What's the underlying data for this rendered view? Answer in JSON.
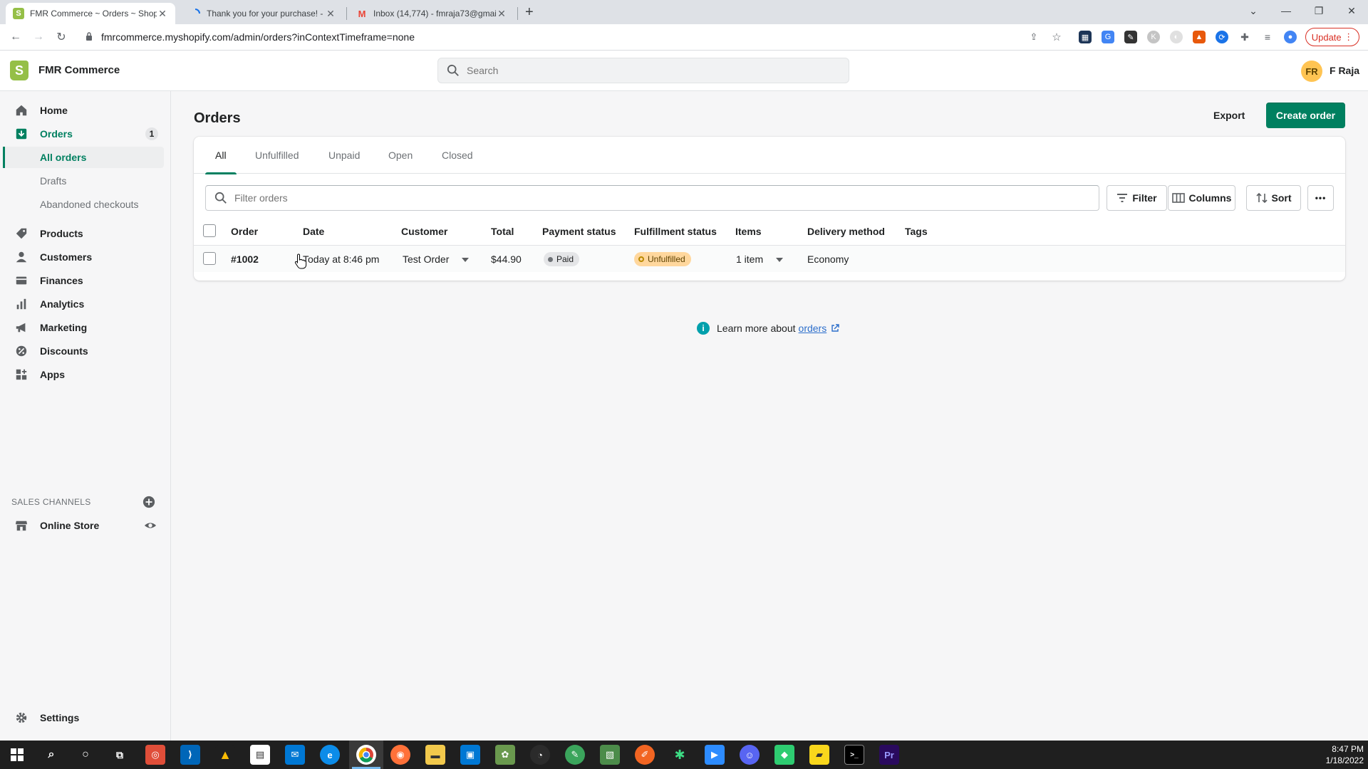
{
  "browser": {
    "tabs": [
      {
        "title": "FMR Commerce ~ Orders ~ Shop",
        "active": true
      },
      {
        "title": "Thank you for your purchase! - F"
      },
      {
        "title": "Inbox (14,774) - fmraja73@gmail"
      }
    ],
    "new_tab": "+",
    "url": "fmrcommerce.myshopify.com/admin/orders?inContextTimeframe=none",
    "update_label": "Update"
  },
  "topbar": {
    "store_name": "FMR Commerce",
    "search_placeholder": "Search",
    "avatar_initials": "FR",
    "user_name": "F Raja"
  },
  "sidebar": {
    "items": [
      {
        "label": "Home",
        "icon": "home-icon"
      },
      {
        "label": "Orders",
        "icon": "orders-icon",
        "badge": "1"
      },
      {
        "label": "Products",
        "icon": "tag-icon"
      },
      {
        "label": "Customers",
        "icon": "person-icon"
      },
      {
        "label": "Finances",
        "icon": "finances-icon"
      },
      {
        "label": "Analytics",
        "icon": "bar-chart-icon"
      },
      {
        "label": "Marketing",
        "icon": "megaphone-icon"
      },
      {
        "label": "Discounts",
        "icon": "discount-icon"
      },
      {
        "label": "Apps",
        "icon": "apps-icon"
      }
    ],
    "order_subitems": [
      "All orders",
      "Drafts",
      "Abandoned checkouts"
    ],
    "sales_channels_label": "SALES CHANNELS",
    "online_store": "Online Store",
    "settings": "Settings"
  },
  "main": {
    "title": "Orders",
    "export_label": "Export",
    "create_label": "Create order",
    "tabs": [
      "All",
      "Unfulfilled",
      "Unpaid",
      "Open",
      "Closed"
    ],
    "filter_placeholder": "Filter orders",
    "filter_label": "Filter",
    "columns_label": "Columns",
    "sort_label": "Sort",
    "more_label": "•••",
    "headers": [
      "Order",
      "Date",
      "Customer",
      "Total",
      "Payment status",
      "Fulfillment status",
      "Items",
      "Delivery method",
      "Tags"
    ],
    "rows": [
      {
        "order": "#1002",
        "date": "Today at 8:46 pm",
        "customer": "Test Order",
        "total": "$44.90",
        "payment": "Paid",
        "fulfillment": "Unfulfilled",
        "items": "1 item",
        "delivery": "Economy",
        "tags": ""
      }
    ],
    "learn_text": "Learn more about",
    "learn_link": "orders"
  },
  "colors": {
    "primary": "#008060",
    "paid_badge": "#e4e5e7",
    "unfulfilled_badge": "#ffd79d",
    "info": "#00a0ac",
    "link": "#2c6ecb"
  },
  "taskbar": {
    "time": "8:47 PM",
    "date": "1/18/2022"
  }
}
